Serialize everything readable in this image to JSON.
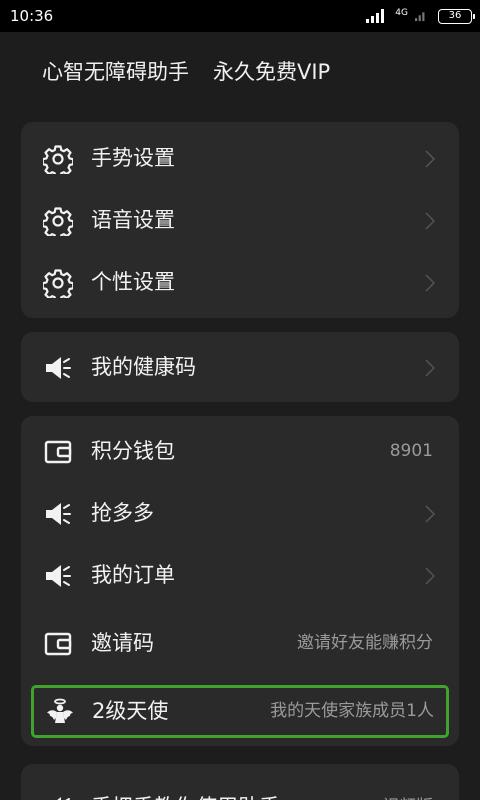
{
  "status_bar": {
    "time": "10:36",
    "network": "4G",
    "battery": "36"
  },
  "header": {
    "app_name": "心智无障碍助手",
    "vip_text": "永久免费VIP"
  },
  "settings_card": {
    "items": [
      {
        "label": "手势设置",
        "icon": "gear-icon"
      },
      {
        "label": "语音设置",
        "icon": "gear-icon"
      },
      {
        "label": "个性设置",
        "icon": "gear-icon"
      }
    ]
  },
  "health_card": {
    "label": "我的健康码",
    "icon": "speaker-icon"
  },
  "account_card": {
    "wallet": {
      "label": "积分钱包",
      "value": "8901",
      "icon": "wallet-icon"
    },
    "qiang": {
      "label": "抢多多",
      "icon": "speaker-icon"
    },
    "orders": {
      "label": "我的订单",
      "icon": "speaker-icon"
    },
    "invite": {
      "label": "邀请码",
      "value": "邀请好友能赚积分",
      "icon": "wallet-icon"
    },
    "angel": {
      "label": "2级天使",
      "value": "我的天使家族成员1人",
      "icon": "angel-icon"
    }
  },
  "tutorial_card": {
    "label": "手把手教你使用助手",
    "value": "视频版"
  },
  "colors": {
    "highlight_border": "#3fa32c",
    "card_bg": "#2a2a2a",
    "page_bg": "#1d1d1d"
  }
}
